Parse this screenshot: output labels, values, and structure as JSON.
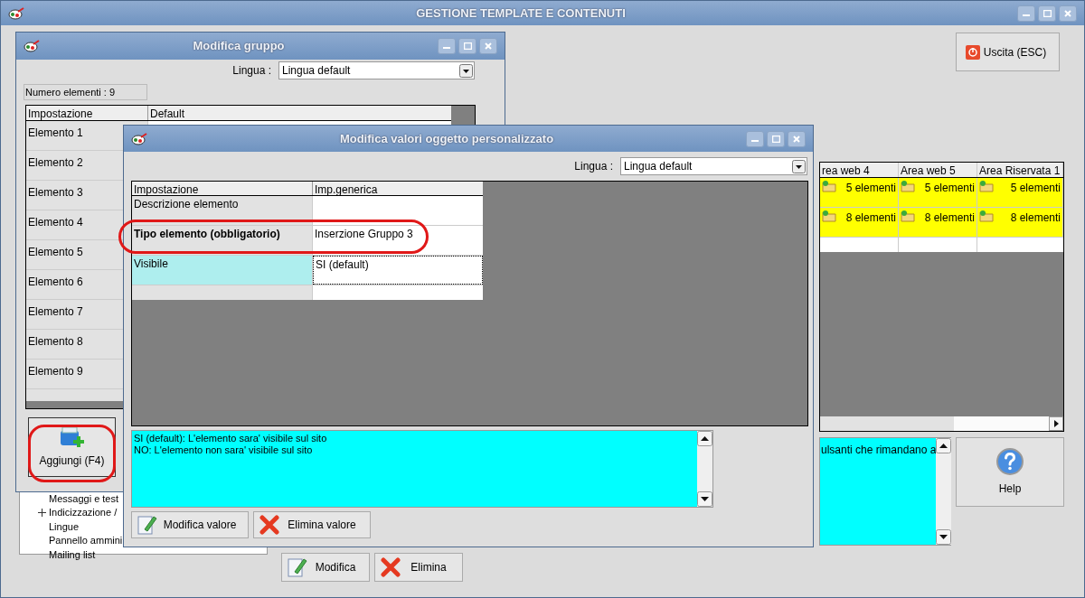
{
  "main_window": {
    "title": "GESTIONE TEMPLATE E CONTENUTI",
    "exit_button": "Uscita (ESC)",
    "grid": {
      "columns": [
        "rea web 4",
        "Area web 5",
        "Area Riservata 1"
      ],
      "rows": [
        [
          "5 elementi",
          "5 elementi",
          "5 elementi"
        ],
        [
          "8 elementi",
          "8 elementi",
          "8 elementi"
        ]
      ]
    },
    "description": "ulsanti che rimandano a",
    "help_button": "Help",
    "tree": [
      {
        "label": "Messaggi e test",
        "expandable": false
      },
      {
        "label": "Indicizzazione /",
        "expandable": true
      },
      {
        "label": "Lingue",
        "expandable": false
      },
      {
        "label": "Pannello ammini",
        "expandable": false
      },
      {
        "label": "Mailing list",
        "expandable": false
      }
    ],
    "buttons": [
      {
        "label": "Modifica",
        "kind": "edit"
      },
      {
        "label": "Elimina",
        "kind": "delete"
      }
    ]
  },
  "group_window": {
    "title": "Modifica gruppo",
    "language_label": "Lingua :",
    "language_value": "Lingua default",
    "count": "Numero elementi : 9",
    "columns": [
      "Impostazione",
      "Default"
    ],
    "rows": [
      "Elemento 1",
      "Elemento 2",
      "Elemento 3",
      "Elemento 4",
      "Elemento 5",
      "Elemento 6",
      "Elemento 7",
      "Elemento 8",
      "Elemento 9"
    ],
    "add_button": "Aggiungi (F4)"
  },
  "values_window": {
    "title": "Modifica valori oggetto personalizzato",
    "language_label": "Lingua :",
    "language_value": "Lingua default",
    "columns": [
      "Impostazione",
      "Imp.generica"
    ],
    "rows": [
      {
        "setting": "Descrizione elemento",
        "required": false,
        "selected": false
      },
      {
        "setting": "Tipo elemento (obbligatorio)",
        "value": "Inserzione Gruppo 3",
        "required": true,
        "selected": false
      },
      {
        "setting": "Visibile",
        "value": "SI (default)",
        "required": false,
        "selected": true
      }
    ],
    "info": [
      "SI (default): L'elemento sara' visibile sul sito",
      "NO: L'elemento non sara' visibile sul sito"
    ],
    "buttons": [
      {
        "label": "Modifica valore",
        "kind": "edit"
      },
      {
        "label": "Elimina valore",
        "kind": "delete"
      }
    ]
  }
}
